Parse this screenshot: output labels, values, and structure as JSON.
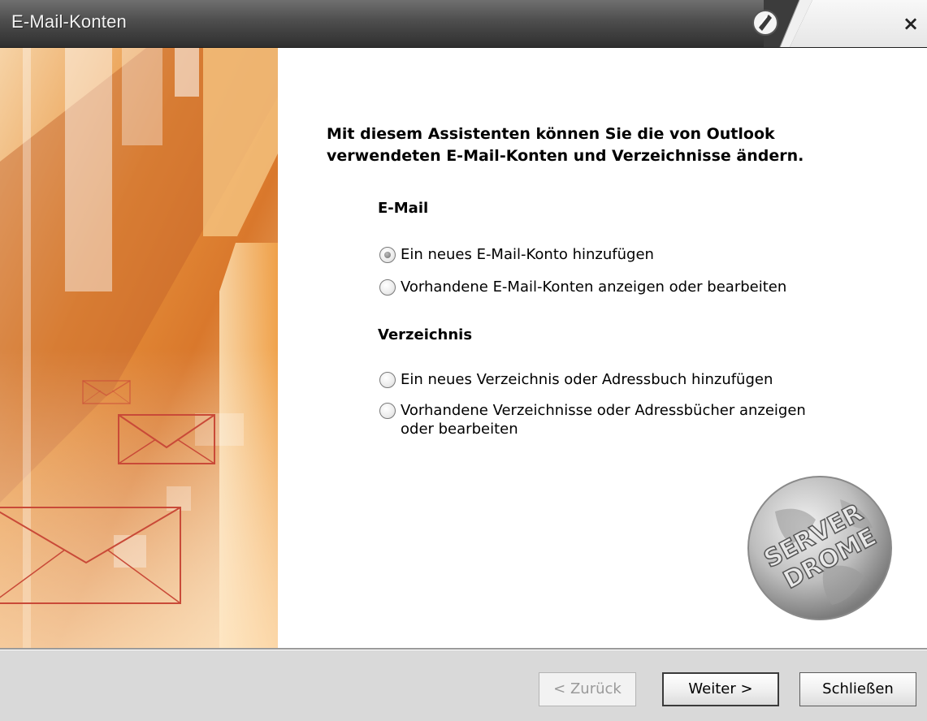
{
  "window": {
    "title": "E-Mail-Konten",
    "close_label": "×"
  },
  "main": {
    "heading_line1": "Mit diesem Assistenten können Sie die von Outlook",
    "heading_line2": "verwendeten E-Mail-Konten und Verzeichnisse ändern.",
    "email_section": {
      "title": "E-Mail",
      "options": [
        {
          "label": "Ein neues E-Mail-Konto hinzufügen",
          "selected": true
        },
        {
          "label": "Vorhandene E-Mail-Konten anzeigen oder bearbeiten",
          "selected": false
        }
      ]
    },
    "directory_section": {
      "title": "Verzeichnis",
      "options": [
        {
          "label": "Ein neues Verzeichnis oder Adressbuch hinzufügen",
          "selected": false
        },
        {
          "label_line1": "Vorhandene Verzeichnisse oder Adressbücher anzeigen",
          "label_line2": "oder bearbeiten",
          "selected": false
        }
      ]
    },
    "watermark_text": {
      "line1": "SERVER",
      "line2": "DROME"
    }
  },
  "footer": {
    "back_label": "< Zurück",
    "next_label": "Weiter >",
    "close_label": "Schließen"
  },
  "icons": {
    "title_icon": "office-logo-icon",
    "close": "close-icon",
    "envelope": "envelope-icon",
    "globe": "globe-watermark-icon"
  },
  "colors": {
    "titlebar": "#4d4d4d",
    "art_orange": "#e08a2e",
    "envelope_stroke": "#c94a38",
    "footer_bg": "#d9d9d9"
  }
}
